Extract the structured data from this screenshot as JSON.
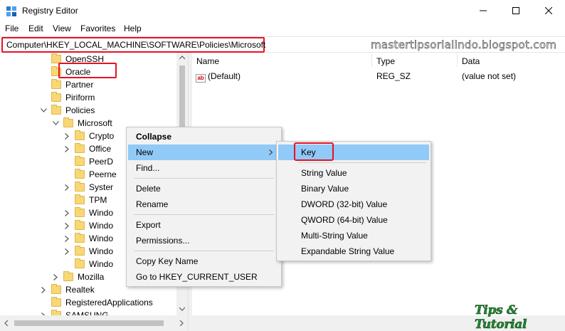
{
  "window": {
    "title": "Registry Editor"
  },
  "menu": [
    "File",
    "Edit",
    "View",
    "Favorites",
    "Help"
  ],
  "address": {
    "path": "Computer\\HKEY_LOCAL_MACHINE\\SOFTWARE\\Policies\\Microsoft"
  },
  "watermark": "mastertipsorialindo.blogspot.com",
  "tree": {
    "items": [
      {
        "label": "OpenSSH",
        "depth": 1,
        "expander": "none"
      },
      {
        "label": "Oracle",
        "depth": 1,
        "expander": "none"
      },
      {
        "label": "Partner",
        "depth": 1,
        "expander": "none"
      },
      {
        "label": "Piriform",
        "depth": 1,
        "expander": "none"
      },
      {
        "label": "Policies",
        "depth": 1,
        "expander": "expanded"
      },
      {
        "label": "Microsoft",
        "depth": 2,
        "expander": "expanded",
        "selected": true
      },
      {
        "label": "Crypto",
        "depth": 3,
        "expander": "collapsed"
      },
      {
        "label": "Office",
        "depth": 3,
        "expander": "collapsed"
      },
      {
        "label": "PeerD",
        "depth": 3,
        "expander": "none"
      },
      {
        "label": "Peerne",
        "depth": 3,
        "expander": "none"
      },
      {
        "label": "Syster",
        "depth": 3,
        "expander": "collapsed"
      },
      {
        "label": "TPM",
        "depth": 3,
        "expander": "none"
      },
      {
        "label": "Windo",
        "depth": 3,
        "expander": "collapsed"
      },
      {
        "label": "Windo",
        "depth": 3,
        "expander": "collapsed"
      },
      {
        "label": "Windo",
        "depth": 3,
        "expander": "collapsed"
      },
      {
        "label": "Windo",
        "depth": 3,
        "expander": "collapsed"
      },
      {
        "label": "Windo",
        "depth": 3,
        "expander": "none"
      },
      {
        "label": "Mozilla",
        "depth": 2,
        "expander": "collapsed"
      },
      {
        "label": "Realtek",
        "depth": 1,
        "expander": "collapsed"
      },
      {
        "label": "RegisteredApplications",
        "depth": 1,
        "expander": "none"
      },
      {
        "label": "SAMSUNG",
        "depth": 1,
        "expander": "collapsed"
      }
    ]
  },
  "list": {
    "columns": {
      "name": "Name",
      "type": "Type",
      "data": "Data"
    },
    "rows": [
      {
        "name": "(Default)",
        "type": "REG_SZ",
        "data": "(value not set)"
      }
    ]
  },
  "context_menu": {
    "items": [
      {
        "label": "Collapse",
        "bold": true
      },
      {
        "label": "New",
        "submenu": true,
        "highlighted": true
      },
      {
        "label": "Find..."
      },
      {
        "separator": true
      },
      {
        "label": "Delete"
      },
      {
        "label": "Rename"
      },
      {
        "separator": true
      },
      {
        "label": "Export"
      },
      {
        "label": "Permissions..."
      },
      {
        "separator": true
      },
      {
        "label": "Copy Key Name"
      },
      {
        "label": "Go to HKEY_CURRENT_USER"
      }
    ]
  },
  "submenu": {
    "items": [
      {
        "label": "Key",
        "highlighted": true
      },
      {
        "separator": true
      },
      {
        "label": "String Value"
      },
      {
        "label": "Binary Value"
      },
      {
        "label": "DWORD (32-bit) Value"
      },
      {
        "label": "QWORD (64-bit) Value"
      },
      {
        "label": "Multi-String Value"
      },
      {
        "label": "Expandable String Value"
      }
    ]
  },
  "logo": "Tips & Tutorial",
  "colors": {
    "highlight": "#91c9f7",
    "annotation": "#e81123",
    "folder": "#f8d775"
  },
  "icons": {
    "app": "registry-editor-icon",
    "minimize": "minimize-icon",
    "maximize": "maximize-icon",
    "close": "close-icon",
    "value": "string-value-icon"
  }
}
